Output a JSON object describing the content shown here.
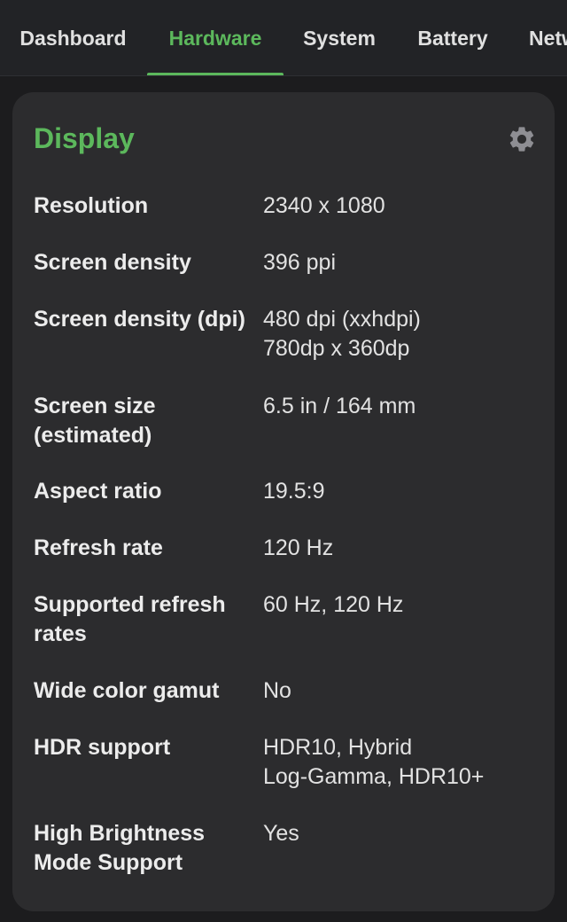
{
  "tabs": [
    {
      "label": "Dashboard"
    },
    {
      "label": "Hardware"
    },
    {
      "label": "System"
    },
    {
      "label": "Battery"
    },
    {
      "label": "Netw"
    }
  ],
  "active_tab": "Hardware",
  "colors": {
    "accent": "#5cb85c",
    "card": "#2c2c2e",
    "background": "#1c1c1e"
  },
  "card": {
    "title": "Display",
    "settings_icon": "gear-icon",
    "rows": [
      {
        "label": [
          "Resolution"
        ],
        "value": [
          "2340 x 1080"
        ]
      },
      {
        "label": [
          "Screen density"
        ],
        "value": [
          "396 ppi"
        ]
      },
      {
        "label": [
          "Screen density (dpi)"
        ],
        "value": [
          "480 dpi (xxhdpi)",
          "780dp x 360dp"
        ]
      },
      {
        "label": [
          "Screen size",
          "(estimated)"
        ],
        "value": [
          "6.5 in / 164 mm"
        ]
      },
      {
        "label": [
          "Aspect ratio"
        ],
        "value": [
          "19.5:9"
        ]
      },
      {
        "label": [
          "Refresh rate"
        ],
        "value": [
          "120 Hz"
        ]
      },
      {
        "label": [
          "Supported refresh",
          "rates"
        ],
        "value": [
          "60 Hz, 120 Hz"
        ]
      },
      {
        "label": [
          "Wide color gamut"
        ],
        "value": [
          "No"
        ]
      },
      {
        "label": [
          "HDR support"
        ],
        "value": [
          "HDR10, Hybrid",
          "Log-Gamma, HDR10+"
        ]
      },
      {
        "label": [
          "High Brightness",
          "Mode Support"
        ],
        "value": [
          "Yes"
        ]
      }
    ]
  }
}
